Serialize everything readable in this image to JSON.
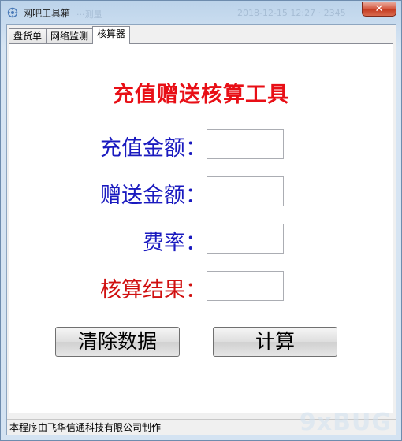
{
  "window": {
    "title": "网吧工具箱",
    "ghost_left": "···测量",
    "ghost_right": "2018-12-15 12:27  · 2345",
    "close_label": "✕"
  },
  "tabs": [
    {
      "label": "盘货单",
      "active": false
    },
    {
      "label": "网络监测",
      "active": false
    },
    {
      "label": "核算器",
      "active": true
    }
  ],
  "calculator": {
    "heading": "充值赠送核算工具",
    "recharge_label": "充值金额：",
    "recharge_value": "",
    "bonus_label": "赠送金额：",
    "bonus_value": "",
    "rate_label": "费率：",
    "rate_value": "",
    "result_label": "核算结果：",
    "result_value": "",
    "clear_button": "清除数据",
    "calc_button": "计算"
  },
  "status": {
    "text": "本程序由飞华信通科技有限公司制作"
  },
  "watermark": "9xBUG",
  "colors": {
    "heading": "#e80f16",
    "label_blue": "#1a1abf",
    "label_red": "#d01010"
  }
}
